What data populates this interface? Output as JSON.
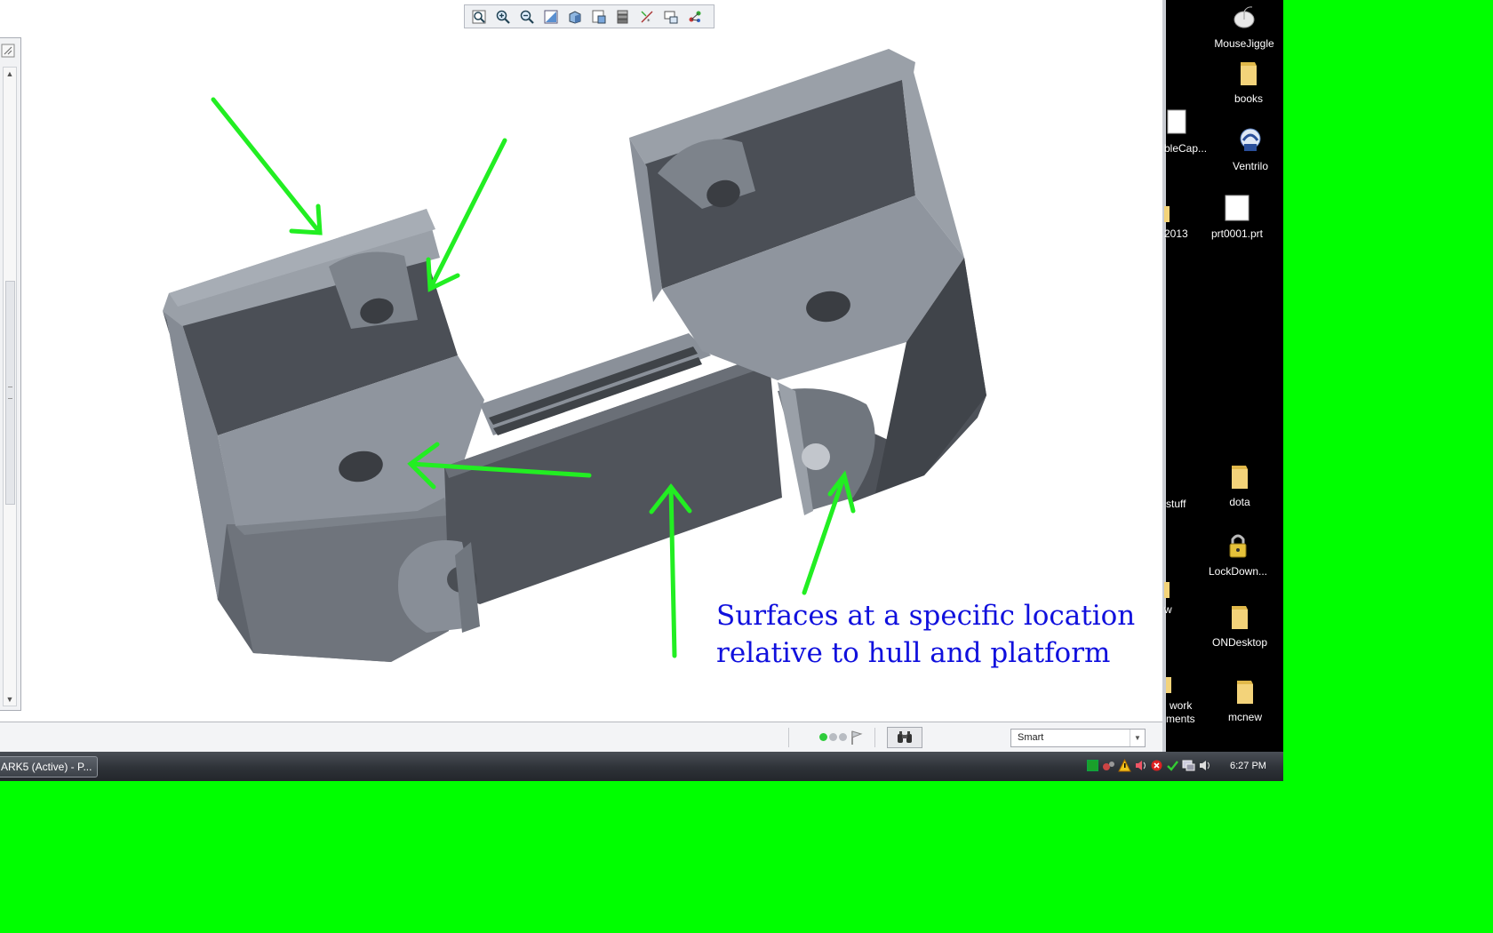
{
  "toolbar": {
    "buttons": [
      {
        "icon": "refit-icon"
      },
      {
        "icon": "zoom-in-icon"
      },
      {
        "icon": "zoom-out-icon"
      },
      {
        "icon": "repaint-icon"
      },
      {
        "icon": "shading-icon"
      },
      {
        "icon": "saved-views-icon"
      },
      {
        "icon": "layers-icon"
      },
      {
        "icon": "datum-display-icon"
      },
      {
        "icon": "annotation-display-icon"
      },
      {
        "icon": "spin-center-icon"
      }
    ]
  },
  "model": {
    "part_color": "#8c939c",
    "annotation_color": "#1010dd",
    "arrow_color": "#22ee22",
    "annotation_lines": [
      "Surfaces at a specific location",
      "relative to hull and platform"
    ]
  },
  "status_bar": {
    "filter_value": "Smart"
  },
  "taskbar": {
    "task_label": "ARK5 (Active) - P...",
    "clock": "6:27 PM"
  },
  "desktop": {
    "icons": [
      {
        "label": "MouseJiggle",
        "icon": "mouse-icon"
      },
      {
        "label": "books",
        "icon": "folder-icon"
      },
      {
        "label": "bleCap...",
        "icon": "document-icon"
      },
      {
        "label": "Ventrilo",
        "icon": "ventrilo-icon"
      },
      {
        "label": "prt0001.prt",
        "icon": "document-icon"
      },
      {
        "label": "2013",
        "icon": "folder-icon"
      },
      {
        "label": "stuff",
        "icon": "folder-icon"
      },
      {
        "label": "dota",
        "icon": "folder-icon"
      },
      {
        "label": "LockDown...",
        "icon": "lock-icon"
      },
      {
        "label": "w",
        "icon": "folder-icon"
      },
      {
        "label": "ONDesktop",
        "icon": "folder-icon"
      },
      {
        "label": "work",
        "icon": "folder-icon"
      },
      {
        "label": "ments",
        "icon": "folder-icon"
      },
      {
        "label": "mcnew",
        "icon": "folder-icon"
      }
    ]
  },
  "colors": {
    "background": "#00ff00",
    "desktop": "#000000",
    "taskbar": "#2e3238"
  }
}
